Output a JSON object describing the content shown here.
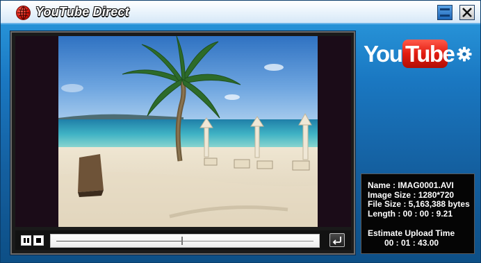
{
  "window": {
    "title": "YouTube Direct",
    "icons": {
      "app": "globe-icon",
      "minimize": "minimize-icon",
      "close": "close-icon"
    }
  },
  "player": {
    "preview": "beach-video-frame",
    "controls": {
      "pause_icon": "pause-icon",
      "stop_icon": "stop-icon",
      "repeat_icon": "repeat-icon"
    },
    "progress": 0.49
  },
  "branding": {
    "you": "You",
    "tube": "Tube",
    "settings_icon": "gear-icon",
    "accent": "#e21c10"
  },
  "file_info": {
    "name": "Name : IMAG0001.AVI",
    "image_size": "Image Size : 1280*720",
    "file_size": "File Size : 5,163,388 bytes",
    "length": "Length : 00 : 00 : 9.21",
    "upload_label": "Estimate Upload Time",
    "upload_time": "00 : 01 : 43.00"
  }
}
